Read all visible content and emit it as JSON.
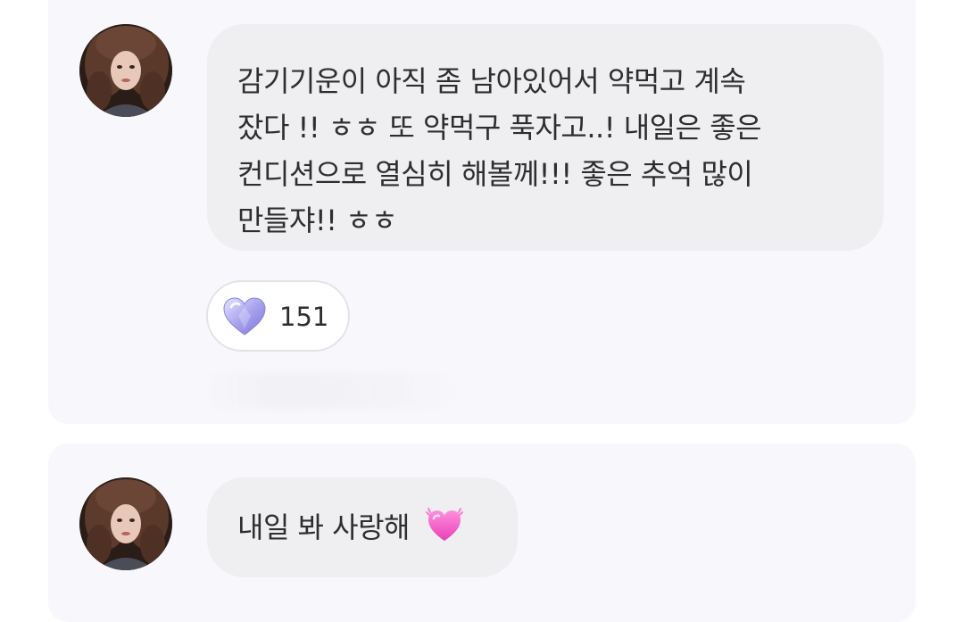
{
  "comments": [
    {
      "avatar_icon": "profile-photo-avatar",
      "message_lines": [
        "감기기운이 아직 좀 남아있어서 약먹고 계속",
        "잤다 !! ㅎㅎ 또 약먹구 푹자고..! 내일은 좋은",
        "컨디션으로 열심히 해볼께!!! 좋은 추억 많이",
        "만들쟈!! ㅎㅎ"
      ],
      "reaction": {
        "icon": "crystal-heart-icon",
        "count": "151"
      }
    },
    {
      "avatar_icon": "profile-photo-avatar",
      "message": "내일 봐 사랑해",
      "emoji": "pink-heart-emoji"
    }
  ],
  "colors": {
    "card_background": "#f8f8fc",
    "bubble_background": "#efeff1",
    "text": "#2e2e30",
    "reaction_border": "#e3e3e7"
  }
}
